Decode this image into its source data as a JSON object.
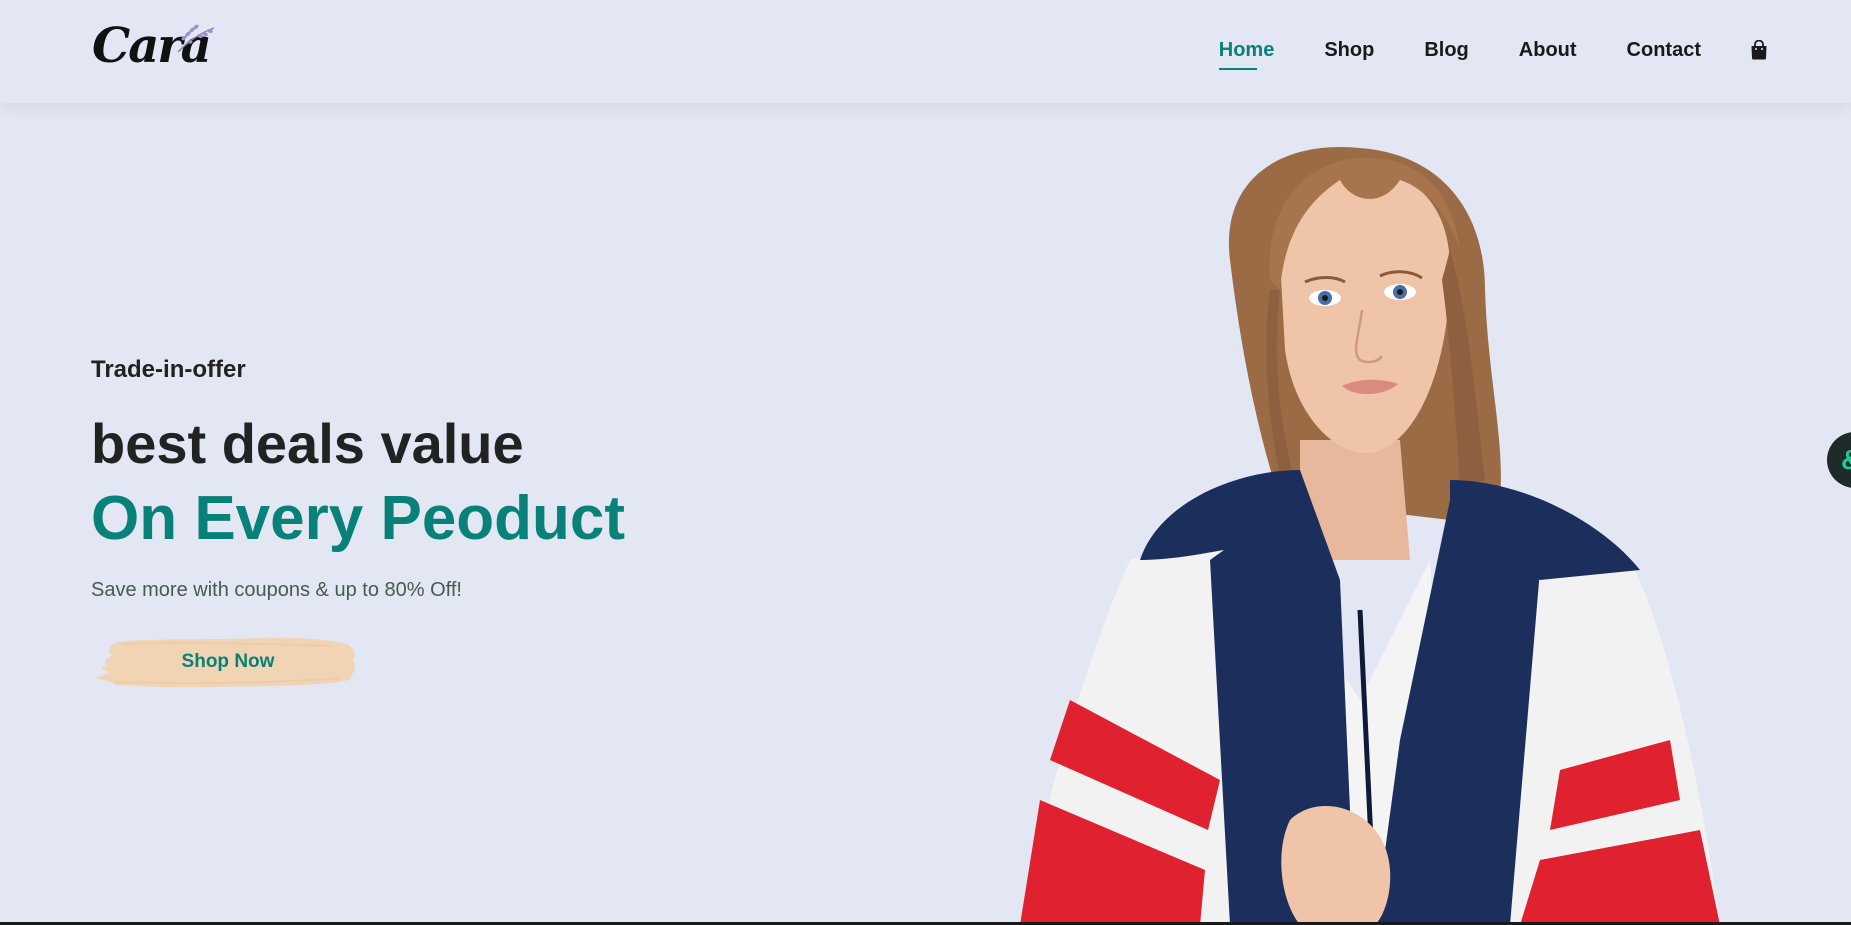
{
  "brand": {
    "logo_text": "Cara"
  },
  "nav": {
    "items": [
      {
        "label": "Home",
        "active": true
      },
      {
        "label": "Shop",
        "active": false
      },
      {
        "label": "Blog",
        "active": false
      },
      {
        "label": "About",
        "active": false
      },
      {
        "label": "Contact",
        "active": false
      }
    ],
    "cart_icon": "shopping-bag-icon"
  },
  "hero": {
    "offer_label": "Trade-in-offer",
    "headline": "best deals value",
    "headline_accent": "On Every Peoduct",
    "subtext": "Save more with coupons & up to 80% Off!",
    "cta_label": "Shop Now"
  },
  "floating_button": {
    "label": "&"
  },
  "colors": {
    "background": "#e3e6f3",
    "accent": "#088178",
    "button_brush": "#f0d4b4",
    "text_dark": "#222222"
  }
}
